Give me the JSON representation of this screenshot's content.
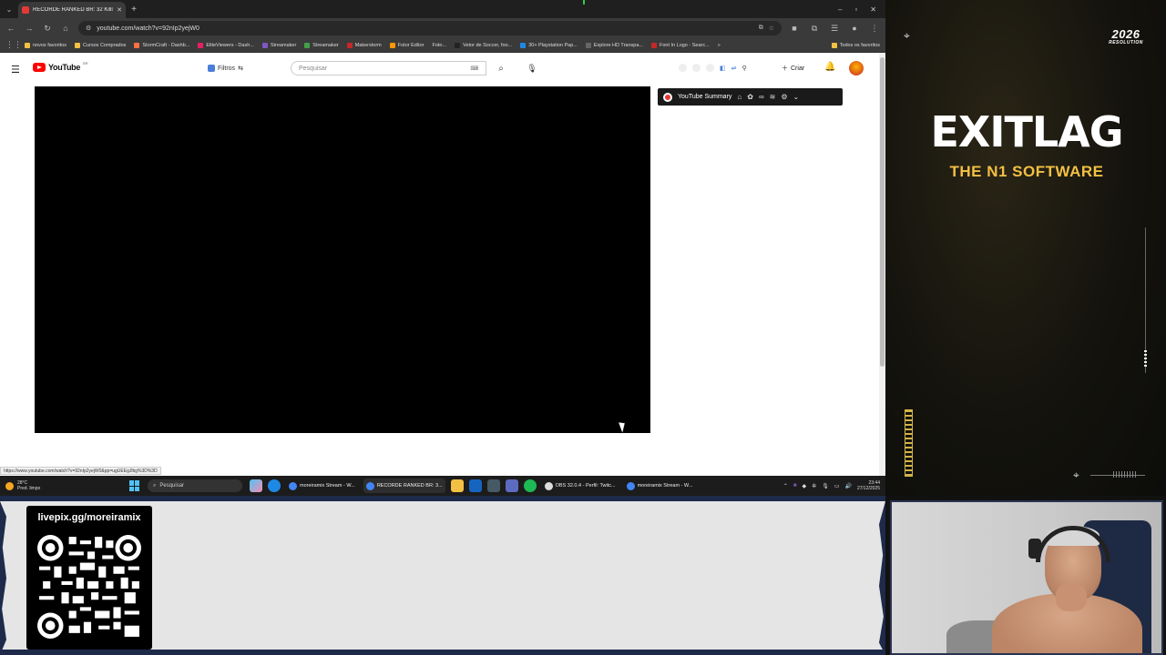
{
  "browser": {
    "tab_title": "RECORDE RANKED BR: 32 Kills",
    "url": "youtube.com/watch?v=92nIp2yejW0",
    "bookmarks": [
      {
        "label": "novos favoritos",
        "color": "#f2c043"
      },
      {
        "label": "Cursos Comprados",
        "color": "#f2c043"
      },
      {
        "label": "StormCraft - Dashb...",
        "color": "#ff7043"
      },
      {
        "label": "EliteViewers - Dash...",
        "color": "#e91e63"
      },
      {
        "label": "Streamaker",
        "color": "#7e57c2"
      },
      {
        "label": "Streamaker",
        "color": "#43a047"
      },
      {
        "label": "Makerstorm",
        "color": "#c62828"
      },
      {
        "label": "Fotor Editor",
        "color": "#ff9800"
      },
      {
        "label": "Foto...",
        "color": "#999999"
      },
      {
        "label": "Vetor de Soccer, foo...",
        "color": "#222222"
      },
      {
        "label": "30+ Playstation Pap...",
        "color": "#1e88e5"
      },
      {
        "label": "Explore HD Transpa...",
        "color": "#666666"
      },
      {
        "label": "Font In Logo - Searc...",
        "color": "#c62828"
      }
    ],
    "bookmarks_more": "Todos os favoritos",
    "status_url": "https://www.youtube.com/watch?v=92nIp2yejW0&pp=ugUEEgJlbg%3D%3D"
  },
  "youtube": {
    "logo_text": "YouTube",
    "region": "BR",
    "filter_label": "Filtros",
    "search_placeholder": "Pesquisar",
    "create_label": "Criar",
    "summary_label": "YouTube Summary"
  },
  "taskbar": {
    "weather_temp": "28°C",
    "weather_desc": "Pred. limpo",
    "search_placeholder": "Pesquisar",
    "tasks": [
      {
        "label": "moreiramix Stream - W...",
        "color": "#4285f4",
        "active": false
      },
      {
        "label": "RECORDE RANKED BR: 3...",
        "color": "#4285f4",
        "active": true
      },
      {
        "label": "OBS 32.0.4 - Perfil: Twitc...",
        "color": "#dddddd",
        "active": false
      },
      {
        "label": "moreiramix Stream - W...",
        "color": "#4285f4",
        "active": false
      }
    ],
    "time": "23:44",
    "date": "27/12/2025"
  },
  "overlay": {
    "resolution_year": "2026",
    "resolution_label": "RESOLUTION",
    "brand": "EXITLAG",
    "tagline": "THE N1 SOFTWARE",
    "accent": "#f2c043"
  },
  "livepix": {
    "title": "livepix.gg/moreiramix"
  }
}
